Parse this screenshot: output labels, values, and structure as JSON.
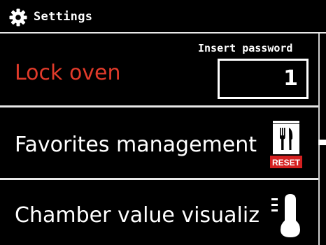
{
  "header": {
    "title": "Settings",
    "icon": "gear-icon"
  },
  "menu": {
    "lock_oven": {
      "label": "Lock oven",
      "password_label": "Insert password",
      "password_value": "1",
      "label_color": "#e03a2a"
    },
    "favorites": {
      "label": "Favorites management",
      "icon": "fork-knife-reset-icon",
      "icon_badge": "RESET"
    },
    "chamber": {
      "label": "Chamber value visualization",
      "icon": "thermometer-icon"
    }
  },
  "colors": {
    "background": "#000000",
    "text": "#ffffff",
    "accent": "#e03a2a",
    "badge": "#d42020"
  }
}
